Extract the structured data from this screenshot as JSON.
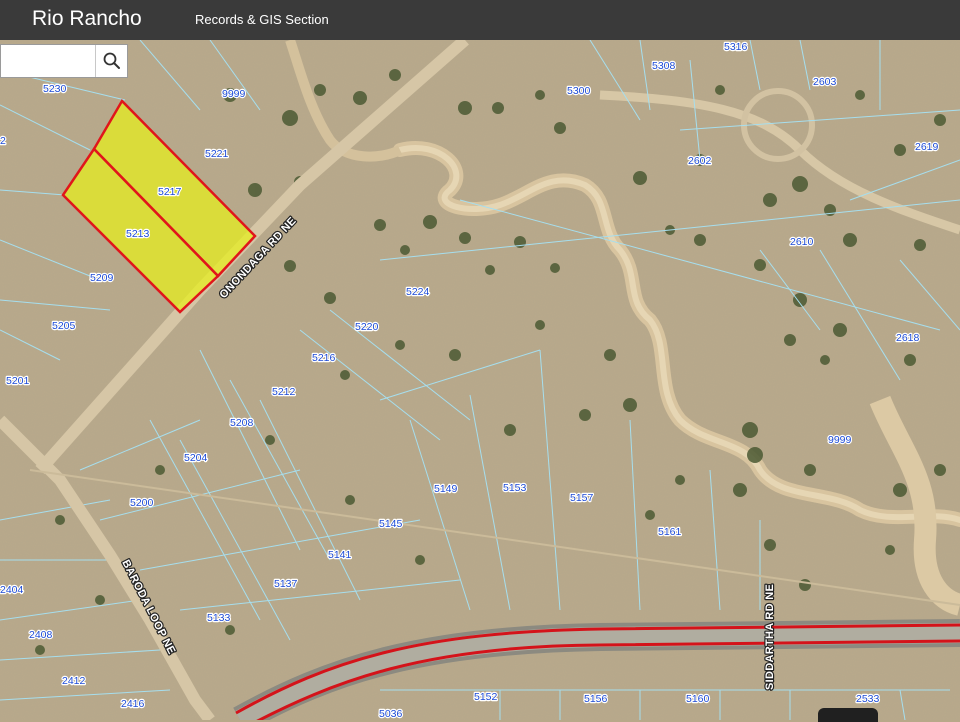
{
  "header": {
    "app_title": "Rio Rancho",
    "section_title": "Records & GIS Section"
  },
  "search": {
    "value": "",
    "placeholder": "",
    "button_icon": "search-icon"
  },
  "colors": {
    "header_bg": "#3a3a3a",
    "parcel_label": "#1d4bd6",
    "selected_outline": "#e0161b",
    "selected_fill": "#e6ee1f",
    "parcel_lines": "#9fdcec"
  },
  "map": {
    "selected_parcels": [
      "5217",
      "5213"
    ],
    "parcels": [
      "5230",
      "9999",
      "5221",
      "5217",
      "5213",
      "5209",
      "5205",
      "5201",
      "2",
      "5316",
      "5308",
      "5300",
      "2603",
      "2619",
      "2602",
      "2610",
      "2618",
      "9999",
      "5224",
      "5220",
      "5216",
      "5212",
      "5208",
      "5204",
      "5200",
      "5149",
      "5153",
      "5157",
      "5161",
      "5145",
      "5141",
      "5137",
      "5133",
      "2404",
      "2408",
      "2412",
      "2416",
      "5036",
      "5152",
      "5156",
      "5160",
      "2533"
    ],
    "roads": [
      "ONONDAGA RD NE",
      "BARODA LOOP NE",
      "SIDDARTHA RD NE"
    ]
  }
}
